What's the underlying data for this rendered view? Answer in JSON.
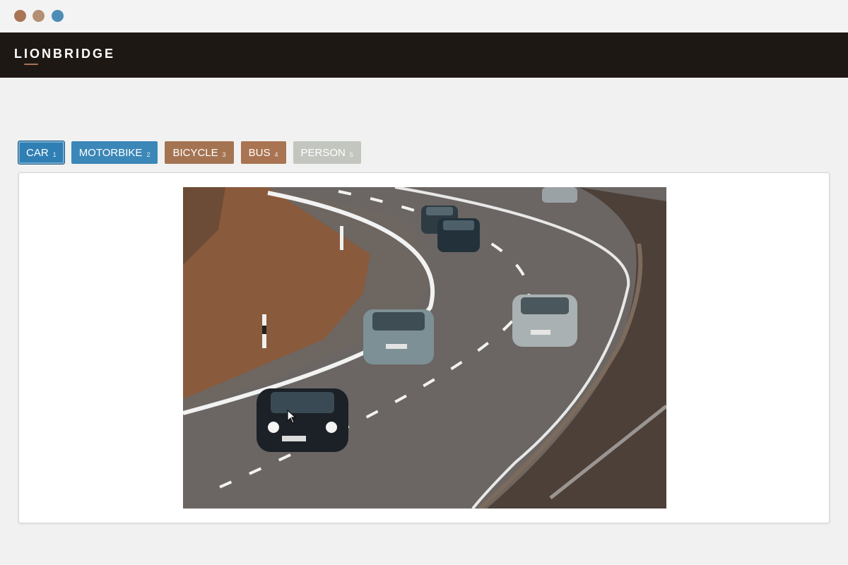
{
  "window": {
    "dots": [
      {
        "name": "window-dot-close",
        "color": "#a87454"
      },
      {
        "name": "window-dot-minimize",
        "color": "#b48f73"
      },
      {
        "name": "window-dot-maximize",
        "color": "#4d8cb6"
      }
    ]
  },
  "header": {
    "logo_text": "LIONBRIDGE",
    "background": "#1e1815",
    "logo_accent_color": "#a8734f"
  },
  "tabs": [
    {
      "label": "CAR",
      "number": "1",
      "color": "#2f7fb5",
      "active": true
    },
    {
      "label": "MOTORBIKE",
      "number": "2",
      "color": "#3b87b8",
      "active": false
    },
    {
      "label": "BICYCLE",
      "number": "3",
      "color": "#a47452",
      "active": false
    },
    {
      "label": "BUS",
      "number": "4",
      "color": "#a97451",
      "active": false
    },
    {
      "label": "PERSON",
      "number": "5",
      "color": "#c2c6bf",
      "active": false
    }
  ],
  "image": {
    "subject": "highway curve with cars"
  }
}
